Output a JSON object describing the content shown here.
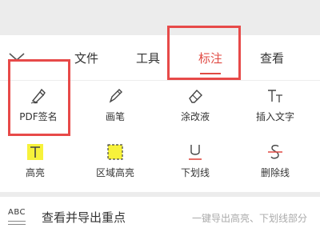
{
  "tabs": [
    {
      "label": "文件"
    },
    {
      "label": "工具"
    },
    {
      "label": "标注"
    },
    {
      "label": "查看"
    }
  ],
  "active_tab": "标注",
  "tools_row1": [
    {
      "label": "PDF签名",
      "icon": "signature-pen-icon"
    },
    {
      "label": "画笔",
      "icon": "pencil-icon"
    },
    {
      "label": "涂改液",
      "icon": "eraser-icon"
    },
    {
      "label": "插入文字",
      "icon": "insert-text-icon"
    }
  ],
  "tools_row2": [
    {
      "label": "高亮",
      "icon": "highlight-icon"
    },
    {
      "label": "区域高亮",
      "icon": "area-highlight-icon"
    },
    {
      "label": "下划线",
      "icon": "underline-icon"
    },
    {
      "label": "删除线",
      "icon": "strikethrough-icon"
    }
  ],
  "bottom": {
    "title": "查看并导出重点",
    "hint": "一键导出高亮、下划线部分",
    "icon_text": "ABC"
  },
  "colors": {
    "accent": "#e04a43",
    "highlight_yellow": "#f7f23b",
    "annotation_box": "#e74a49"
  }
}
